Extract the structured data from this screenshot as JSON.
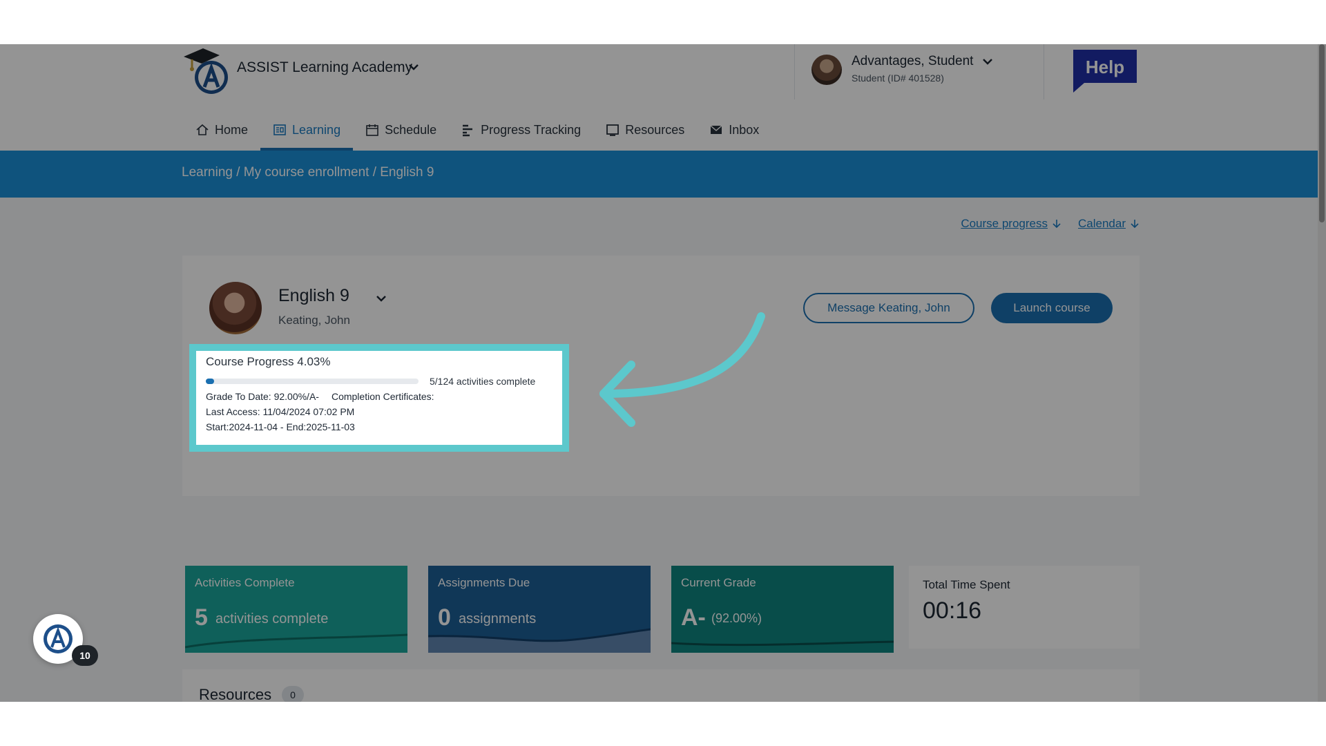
{
  "org": {
    "name": "ASSIST Learning Academy"
  },
  "user": {
    "name": "Advantages, Student",
    "id_text": "Student (ID# 401528)"
  },
  "help": {
    "label": "Help"
  },
  "nav": {
    "items": [
      {
        "label": "Home",
        "icon": "home-icon"
      },
      {
        "label": "Learning",
        "icon": "learning-icon",
        "active": true
      },
      {
        "label": "Schedule",
        "icon": "calendar-icon"
      },
      {
        "label": "Progress Tracking",
        "icon": "bar-chart-icon"
      },
      {
        "label": "Resources",
        "icon": "book-icon"
      },
      {
        "label": "Inbox",
        "icon": "mail-icon"
      }
    ]
  },
  "breadcrumb": "Learning / My course enrollment / English 9",
  "jump_links": {
    "course_progress": "Course progress",
    "calendar": "Calendar"
  },
  "course": {
    "title": "English 9",
    "teacher": "Keating, John",
    "message_button": "Message Keating, John",
    "launch_button": "Launch course",
    "progress": {
      "title": "Course Progress 4.03%",
      "percent": 4.03,
      "count_text": "5/124 activities complete",
      "grade_to_date": "Grade To Date: 92.00%/A-",
      "certificates": "Completion Certificates:",
      "last_access": "Last Access: 11/04/2024 07:02 PM",
      "dates": "Start:2024-11-04 - End:2025-11-03"
    }
  },
  "stats": [
    {
      "label": "Activities Complete",
      "value": "5",
      "unit": "activities complete",
      "color": "#1aa69b"
    },
    {
      "label": "Assignments Due",
      "value": "0",
      "unit": "assignments",
      "color": "#1d5f96"
    },
    {
      "label": "Current Grade",
      "value": "A-",
      "unit": "(92.00%)",
      "color": "#0e8580"
    },
    {
      "label": "Total Time Spent",
      "value": "00:16",
      "color": "#ffffff"
    }
  ],
  "resources": {
    "title": "Resources",
    "count": "0"
  },
  "fab": {
    "badge": "10"
  },
  "colors": {
    "accent": "#1a6fb0",
    "highlight": "#5cc8cc",
    "breadcrumb_bar": "#1a8fd8"
  }
}
